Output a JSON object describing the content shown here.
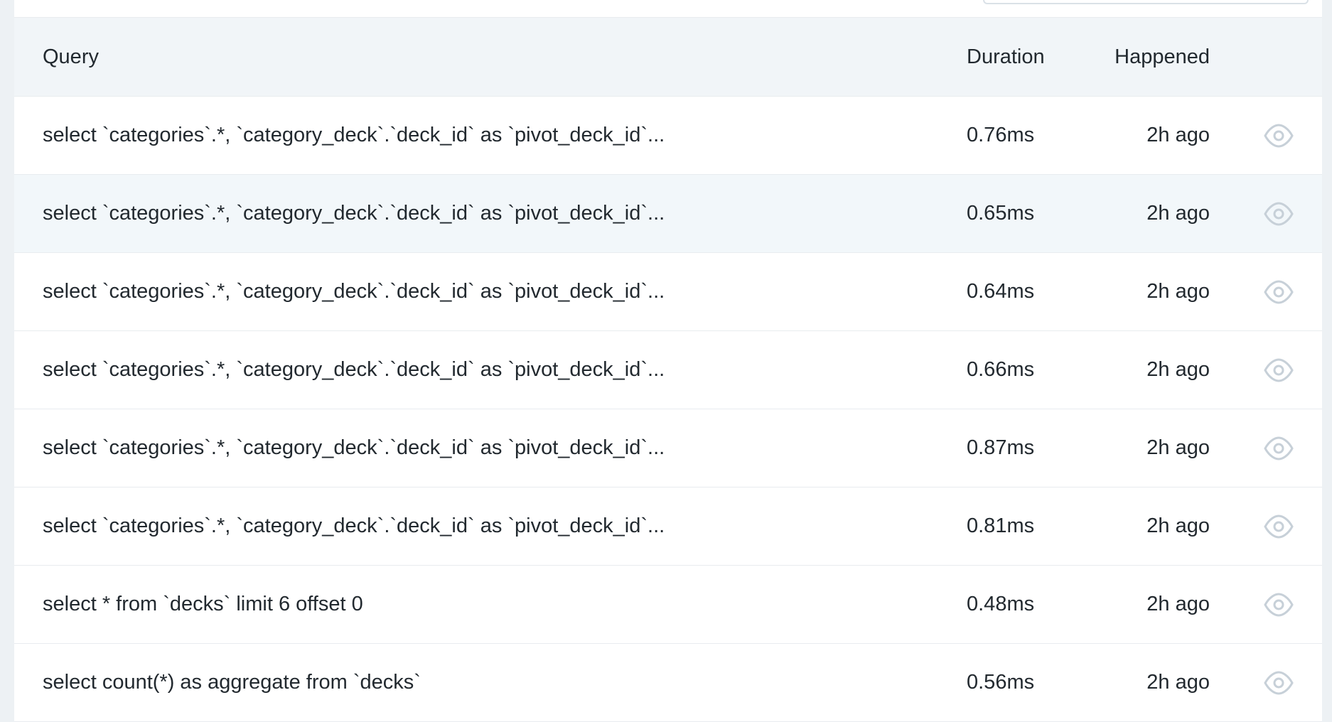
{
  "table": {
    "headers": {
      "query": "Query",
      "duration": "Duration",
      "happened": "Happened"
    },
    "rows": [
      {
        "query": "select `categories`.*, `category_deck`.`deck_id` as `pivot_deck_id`...",
        "duration": "0.76ms",
        "happened": "2h ago",
        "icon": "eye-icon"
      },
      {
        "query": "select `categories`.*, `category_deck`.`deck_id` as `pivot_deck_id`...",
        "duration": "0.65ms",
        "happened": "2h ago",
        "icon": "eye-icon"
      },
      {
        "query": "select `categories`.*, `category_deck`.`deck_id` as `pivot_deck_id`...",
        "duration": "0.64ms",
        "happened": "2h ago",
        "icon": "eye-icon"
      },
      {
        "query": "select `categories`.*, `category_deck`.`deck_id` as `pivot_deck_id`...",
        "duration": "0.66ms",
        "happened": "2h ago",
        "icon": "eye-icon"
      },
      {
        "query": "select `categories`.*, `category_deck`.`deck_id` as `pivot_deck_id`...",
        "duration": "0.87ms",
        "happened": "2h ago",
        "icon": "eye-icon"
      },
      {
        "query": "select `categories`.*, `category_deck`.`deck_id` as `pivot_deck_id`...",
        "duration": "0.81ms",
        "happened": "2h ago",
        "icon": "eye-icon"
      },
      {
        "query": "select * from `decks` limit 6 offset 0",
        "duration": "0.48ms",
        "happened": "2h ago",
        "icon": "eye-icon"
      },
      {
        "query": "select count(*) as aggregate from `decks`",
        "duration": "0.56ms",
        "happened": "2h ago",
        "icon": "eye-icon"
      }
    ]
  },
  "colors": {
    "page_bg": "#edf1f4",
    "header_bg": "#f1f5f8",
    "hover_row_bg": "#f2f7fa",
    "icon": "#c7d0d8"
  }
}
